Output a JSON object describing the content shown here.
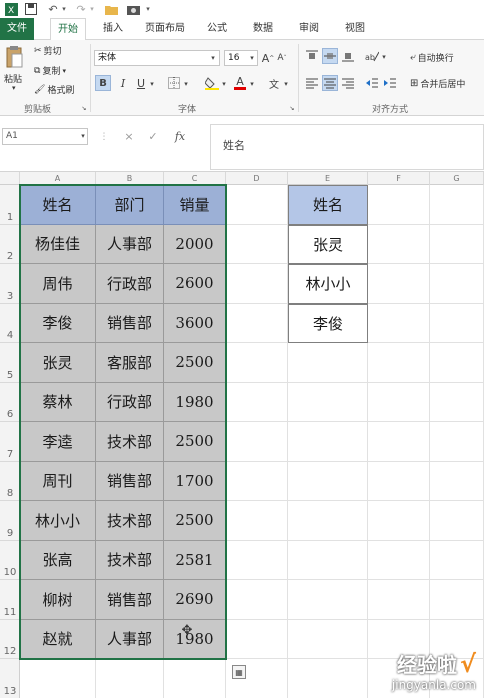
{
  "quick_access": {
    "undo": "↶",
    "redo": "↷"
  },
  "tabs": [
    {
      "label": "文件"
    },
    {
      "label": "开始"
    },
    {
      "label": "插入"
    },
    {
      "label": "页面布局"
    },
    {
      "label": "公式"
    },
    {
      "label": "数据"
    },
    {
      "label": "审阅"
    },
    {
      "label": "视图"
    }
  ],
  "clipboard": {
    "paste": "粘贴",
    "cut": "剪切",
    "copy": "复制",
    "format_painter": "格式刷",
    "group_label": "剪贴板"
  },
  "font": {
    "name": "宋体",
    "size": "16",
    "bold": "B",
    "italic": "I",
    "underline": "U",
    "grow": "A",
    "shrink": "A",
    "font_color_letter": "A",
    "phonetic": "文",
    "group_label": "字体"
  },
  "alignment": {
    "wrap_text": "自动换行",
    "merge_center": "合并后居中",
    "group_label": "对齐方式"
  },
  "formula_bar": {
    "name_box": "A1",
    "cancel": "×",
    "enter": "✓",
    "fx": "fx",
    "content": "姓名"
  },
  "columns": [
    "A",
    "B",
    "C",
    "D",
    "E",
    "F",
    "G"
  ],
  "rows": [
    "1",
    "2",
    "3",
    "4",
    "5",
    "6",
    "7",
    "8",
    "9",
    "10",
    "11",
    "12",
    "13"
  ],
  "table": {
    "headers": [
      "姓名",
      "部门",
      "销量"
    ],
    "rows": [
      [
        "杨佳佳",
        "人事部",
        "2000"
      ],
      [
        "周伟",
        "行政部",
        "2600"
      ],
      [
        "李俊",
        "销售部",
        "3600"
      ],
      [
        "张灵",
        "客服部",
        "2500"
      ],
      [
        "蔡林",
        "行政部",
        "1980"
      ],
      [
        "李逵",
        "技术部",
        "2500"
      ],
      [
        "周刊",
        "销售部",
        "1700"
      ],
      [
        "林小小",
        "技术部",
        "2500"
      ],
      [
        "张高",
        "技术部",
        "2581"
      ],
      [
        "柳树",
        "销售部",
        "2690"
      ],
      [
        "赵就",
        "人事部",
        "1980"
      ]
    ]
  },
  "lookup": {
    "header": "姓名",
    "values": [
      "张灵",
      "林小小",
      "李俊"
    ]
  },
  "watermark": {
    "brand": "经验啦",
    "check": "√",
    "url": "jingyanla.com"
  },
  "colors": {
    "excel_green": "#217346",
    "table_header": "#9cb0d6",
    "table_body": "#c8c8c8",
    "lookup_header": "#b4c6e7",
    "watermark_orange": "#f08c1e"
  }
}
